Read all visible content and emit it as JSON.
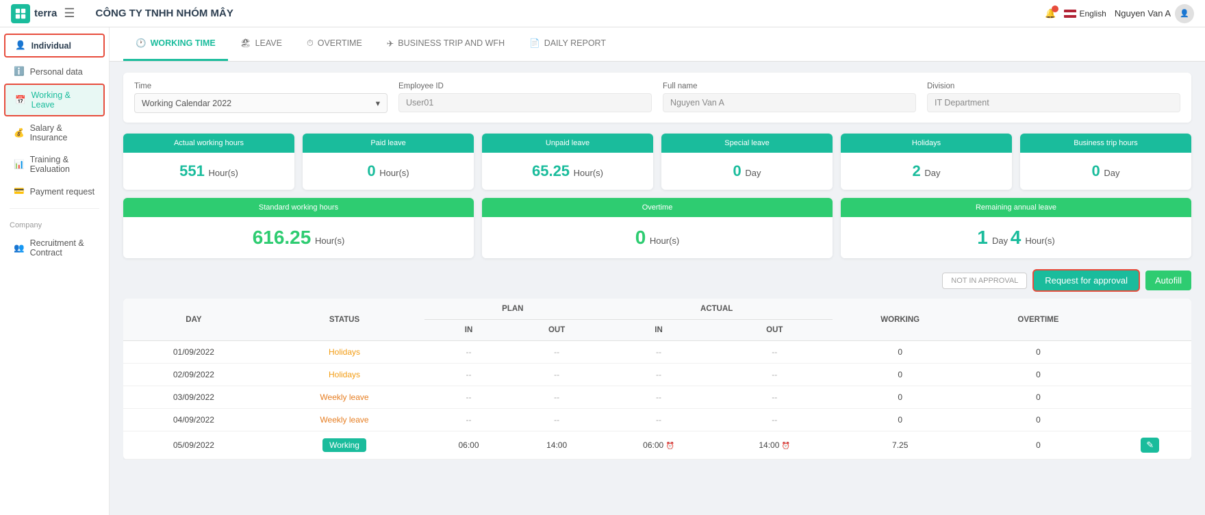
{
  "topbar": {
    "company_name": "CÔNG TY TNHH NHÓM MÂY",
    "logo_text": "terra",
    "lang": "English",
    "user_name": "Nguyen Van A"
  },
  "sidebar": {
    "individual_label": "Individual",
    "items": [
      {
        "id": "personal-data",
        "label": "Personal data",
        "icon": "info"
      },
      {
        "id": "working-leave",
        "label": "Working & Leave",
        "icon": "calendar"
      },
      {
        "id": "salary-insurance",
        "label": "Salary & Insurance",
        "icon": "money"
      },
      {
        "id": "training-evaluation",
        "label": "Training & Evaluation",
        "icon": "chart"
      },
      {
        "id": "payment-request",
        "label": "Payment request",
        "icon": "payment"
      }
    ],
    "company_label": "Company",
    "company_items": [
      {
        "id": "recruitment-contract",
        "label": "Recruitment & Contract",
        "icon": "people"
      }
    ]
  },
  "tabs": [
    {
      "id": "working-time",
      "label": "WORKING TIME",
      "active": true
    },
    {
      "id": "leave",
      "label": "LEAVE"
    },
    {
      "id": "overtime",
      "label": "OVERTIME"
    },
    {
      "id": "business-trip",
      "label": "BUSINESS TRIP AND WFH"
    },
    {
      "id": "daily-report",
      "label": "DAILY REPORT"
    }
  ],
  "filters": {
    "time_label": "Time",
    "time_value": "Working Calendar 2022",
    "employee_id_label": "Employee ID",
    "employee_id_value": "User01",
    "full_name_label": "Full name",
    "full_name_value": "Nguyen Van A",
    "division_label": "Division",
    "division_value": "IT Department"
  },
  "stats_row1": [
    {
      "header": "Actual working hours",
      "value": "551",
      "unit": "Hour(s)"
    },
    {
      "header": "Paid leave",
      "value": "0",
      "unit": "Hour(s)"
    },
    {
      "header": "Unpaid leave",
      "value": "65.25",
      "unit": "Hour(s)"
    },
    {
      "header": "Special leave",
      "value": "0",
      "unit": "Day"
    },
    {
      "header": "Holidays",
      "value": "2",
      "unit": "Day"
    },
    {
      "header": "Business trip hours",
      "value": "0",
      "unit": "Day"
    }
  ],
  "stats_row2": [
    {
      "header": "Standard working hours",
      "value": "616.25",
      "unit": "Hour(s)"
    },
    {
      "header": "Overtime",
      "value": "0",
      "unit": "Hour(s)"
    },
    {
      "header_remaining": "Remaining annual leave",
      "val_day": "1",
      "label_day": "Day",
      "val_hour": "4",
      "label_hour": "Hour(s)"
    }
  ],
  "action_buttons": {
    "not_approval": "NOT IN APPROVAL",
    "request": "Request for approval",
    "autofill": "Autofill"
  },
  "table": {
    "columns": {
      "day": "DAY",
      "status": "STATUS",
      "plan": "PLAN",
      "actual": "ACTUAL",
      "working": "WORKING",
      "overtime": "OVERTIME",
      "plan_in": "IN",
      "plan_out": "OUT",
      "actual_in": "IN",
      "actual_out": "OUT"
    },
    "rows": [
      {
        "day": "01/09/2022",
        "status": "Holidays",
        "status_type": "holidays",
        "plan_in": "--",
        "plan_out": "--",
        "actual_in": "--",
        "actual_out": "--",
        "working": "0",
        "overtime": "0"
      },
      {
        "day": "02/09/2022",
        "status": "Holidays",
        "status_type": "holidays",
        "plan_in": "--",
        "plan_out": "--",
        "actual_in": "--",
        "actual_out": "--",
        "working": "0",
        "overtime": "0"
      },
      {
        "day": "03/09/2022",
        "status": "Weekly leave",
        "status_type": "weekly",
        "plan_in": "--",
        "plan_out": "--",
        "actual_in": "--",
        "actual_out": "--",
        "working": "0",
        "overtime": "0"
      },
      {
        "day": "04/09/2022",
        "status": "Weekly leave",
        "status_type": "weekly",
        "plan_in": "--",
        "plan_out": "--",
        "actual_in": "--",
        "actual_out": "--",
        "working": "0",
        "overtime": "0"
      },
      {
        "day": "05/09/2022",
        "status": "Working",
        "status_type": "working",
        "plan_in": "06:00",
        "plan_out": "14:00",
        "actual_in": "06:00",
        "actual_out": "14:00",
        "working": "7.25",
        "overtime": "0"
      }
    ]
  }
}
